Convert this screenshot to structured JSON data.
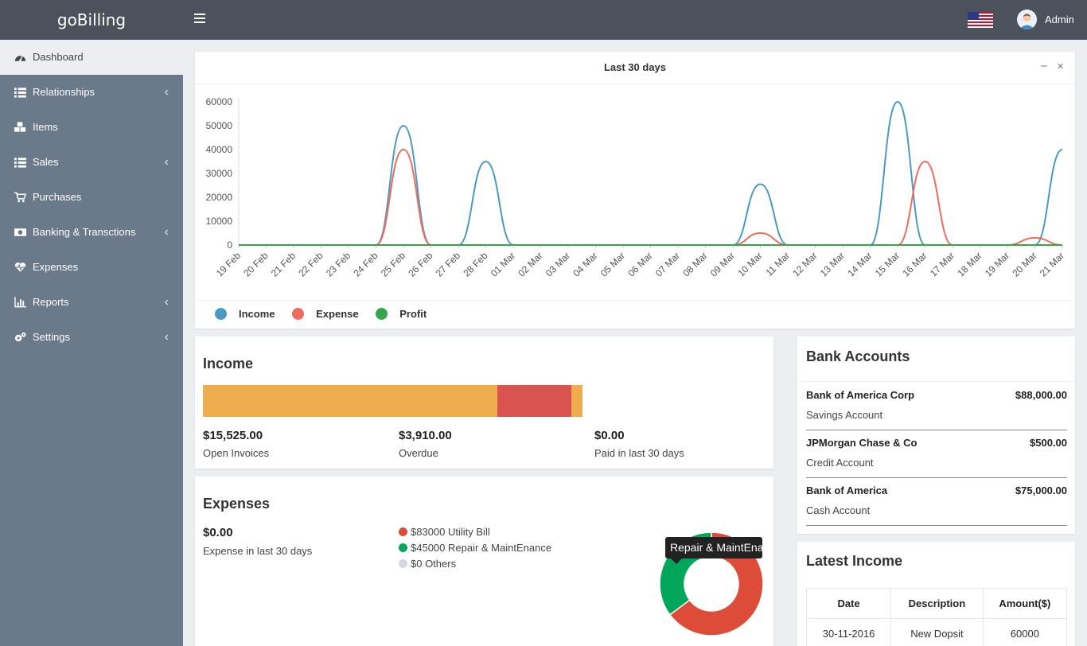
{
  "app": {
    "brand": "goBilling",
    "user": "Admin"
  },
  "sidebar": {
    "items": [
      {
        "label": "Dashboard",
        "icon": "dashboard-icon",
        "active": true,
        "has_chevron": false
      },
      {
        "label": "Relationships",
        "icon": "list-icon",
        "has_chevron": true
      },
      {
        "label": "Items",
        "icon": "cubes-icon",
        "has_chevron": false
      },
      {
        "label": "Sales",
        "icon": "list-icon",
        "has_chevron": true
      },
      {
        "label": "Purchases",
        "icon": "cart-icon",
        "has_chevron": false
      },
      {
        "label": "Banking & Transctions",
        "icon": "money-icon",
        "has_chevron": true
      },
      {
        "label": "Expenses",
        "icon": "heartbeat-icon",
        "has_chevron": false
      },
      {
        "label": "Reports",
        "icon": "bar-chart-icon",
        "has_chevron": true
      },
      {
        "label": "Settings",
        "icon": "cogs-icon",
        "has_chevron": true
      }
    ]
  },
  "chart_panel": {
    "title": "Last 30 days"
  },
  "chart_data": {
    "type": "line",
    "x": [
      "19 Feb",
      "20 Feb",
      "21 Feb",
      "22 Feb",
      "23 Feb",
      "24 Feb",
      "25 Feb",
      "26 Feb",
      "27 Feb",
      "28 Feb",
      "01 Mar",
      "02 Mar",
      "03 Mar",
      "04 Mar",
      "05 Mar",
      "06 Mar",
      "07 Mar",
      "08 Mar",
      "09 Mar",
      "10 Mar",
      "11 Mar",
      "12 Mar",
      "13 Mar",
      "14 Mar",
      "15 Mar",
      "16 Mar",
      "17 Mar",
      "18 Mar",
      "19 Mar",
      "20 Mar",
      "21 Mar"
    ],
    "yticks": [
      0,
      10000,
      20000,
      30000,
      40000,
      50000,
      60000
    ],
    "ylim": [
      0,
      60000
    ],
    "series": [
      {
        "name": "Income",
        "color": "#4a9ac4",
        "values": [
          0,
          0,
          0,
          0,
          0,
          0,
          50000,
          0,
          0,
          35000,
          0,
          0,
          0,
          0,
          0,
          0,
          0,
          0,
          0,
          25500,
          0,
          0,
          0,
          0,
          60000,
          0,
          0,
          0,
          0,
          0,
          40000
        ]
      },
      {
        "name": "Expense",
        "color": "#ee6b5d",
        "values": [
          0,
          0,
          0,
          0,
          0,
          0,
          40000,
          0,
          0,
          0,
          0,
          0,
          0,
          0,
          0,
          0,
          0,
          0,
          0,
          5000,
          0,
          0,
          0,
          0,
          0,
          35000,
          0,
          0,
          0,
          3000,
          0
        ]
      },
      {
        "name": "Profit",
        "color": "#33a84a",
        "values": [
          0,
          0,
          0,
          0,
          0,
          0,
          0,
          0,
          0,
          0,
          0,
          0,
          0,
          0,
          0,
          0,
          0,
          0,
          0,
          0,
          0,
          0,
          0,
          0,
          0,
          0,
          0,
          0,
          0,
          0,
          0
        ]
      }
    ],
    "legend": "bottom-left"
  },
  "income": {
    "title": "Income",
    "bar": [
      {
        "value": 15525,
        "color": "#f0ad4e"
      },
      {
        "value": 3910,
        "color": "#d9534f"
      },
      {
        "value": 600,
        "color": "#f0ad4e"
      }
    ],
    "stats": [
      {
        "value": "$15,525.00",
        "label": "Open Invoices"
      },
      {
        "value": "$3,910.00",
        "label": "Overdue"
      },
      {
        "value": "$0.00",
        "label": "Paid in last 30 days"
      }
    ]
  },
  "expenses": {
    "title": "Expenses",
    "value": "$0.00",
    "label": "Expense in last 30 days",
    "legend": [
      {
        "label": "$83000 Utility Bill",
        "color": "#dd4b39"
      },
      {
        "label": "$45000 Repair & MaintEnance",
        "color": "#00a65a"
      },
      {
        "label": "$0 Others",
        "color": "#d2d6de"
      }
    ],
    "donut": [
      {
        "value": 83000,
        "color": "#dd4b39"
      },
      {
        "value": 45000,
        "color": "#00a65a"
      },
      {
        "value": 0,
        "color": "#d2d6de"
      }
    ],
    "tooltip": "Repair & MaintEnance"
  },
  "bank_accounts": {
    "title": "Bank Accounts",
    "rows": [
      {
        "name": "Bank of America Corp",
        "amount": "$88,000.00",
        "type": "Savings Account"
      },
      {
        "name": "JPMorgan Chase & Co",
        "amount": "$500.00",
        "type": "Credit Account"
      },
      {
        "name": "Bank of America",
        "amount": "$75,000.00",
        "type": "Cash Account"
      }
    ]
  },
  "latest_income": {
    "title": "Latest Income",
    "columns": [
      "Date",
      "Description",
      "Amount($)"
    ],
    "rows": [
      [
        "30-11-2016",
        "New Dopsit",
        "60000"
      ]
    ]
  }
}
